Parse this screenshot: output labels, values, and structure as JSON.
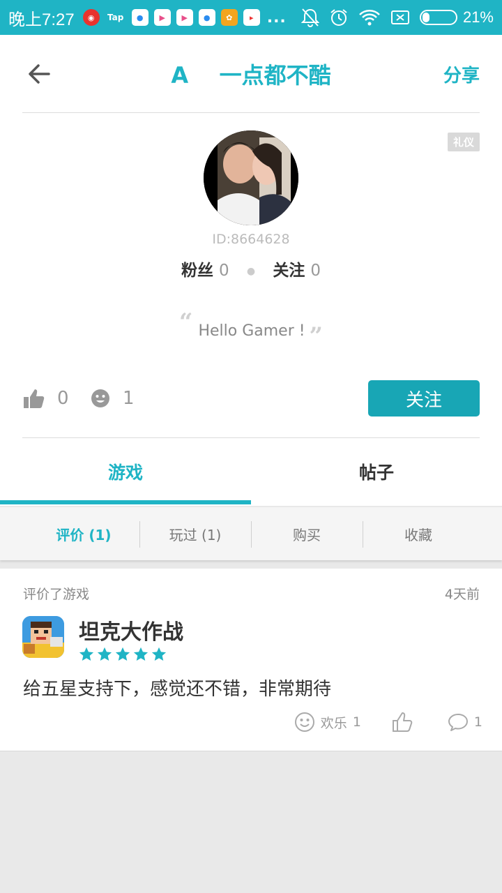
{
  "status_bar": {
    "time": "晚上7:27",
    "notif_tap": "Tap",
    "dots": "...",
    "battery": "21%",
    "battery_level": 0.21
  },
  "nav": {
    "title": "A    一点都不酷",
    "share": "分享"
  },
  "profile": {
    "badge": "礼仪",
    "id_text": "ID:8664628",
    "fans_label": "粉丝",
    "fans_count": "0",
    "following_label": "关注",
    "following_count": "0",
    "quote": "Hello Gamer !",
    "likes": "0",
    "happy": "1",
    "follow_button": "关注"
  },
  "tabs": [
    {
      "label": "游戏",
      "active": true
    },
    {
      "label": "帖子",
      "active": false
    }
  ],
  "subtabs": [
    {
      "label": "评价 (1)",
      "active": true
    },
    {
      "label": "玩过 (1)",
      "active": false
    },
    {
      "label": "购买",
      "active": false
    },
    {
      "label": "收藏",
      "active": false
    }
  ],
  "review": {
    "action": "评价了游戏",
    "time": "4天前",
    "game_name": "坦克大作战",
    "rating": 5,
    "text": "给五星支持下，感觉还不错，非常期待",
    "happy_label": "欢乐",
    "happy_count": "1",
    "comment_count": "1"
  },
  "colors": {
    "accent": "#1fb4c5",
    "button": "#18a6b5"
  }
}
